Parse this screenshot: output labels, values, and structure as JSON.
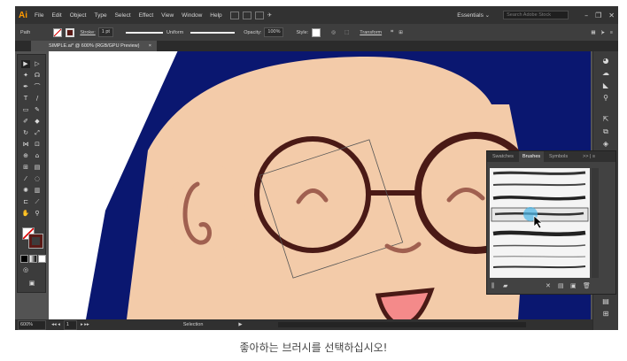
{
  "menubar": {
    "logo": "Ai",
    "items": [
      "File",
      "Edit",
      "Object",
      "Type",
      "Select",
      "Effect",
      "View",
      "Window",
      "Help"
    ],
    "workspace": "Essentials ⌄",
    "search_placeholder": "Search Adobe Stock"
  },
  "control_bar": {
    "selection": "Path",
    "stroke_label": "Stroke:",
    "stroke_weight": "1 pt",
    "profile": "Uniform",
    "opacity_label": "Opacity:",
    "opacity_value": "100%",
    "style_label": "Style:",
    "transform_label": "Transform"
  },
  "document_tab": {
    "title": "SIMPLE.ai* @ 600% (RGB/GPU Preview)",
    "close": "×"
  },
  "status_bar": {
    "zoom": "600%",
    "artboard": "1",
    "tool": "Selection"
  },
  "brushes_panel": {
    "tabs": [
      "Swatches",
      "Brushes",
      "Symbols"
    ],
    "active_tab": "Brushes",
    "menu": ">> | ≡"
  },
  "caption": "좋아하는 브러시를 선택하십시오!",
  "colors": {
    "background_blue": "#0a1770",
    "skin": "#f3cba9",
    "glasses": "#4a1a16",
    "eyes": "#a06050",
    "mouth": "#f48a8a",
    "ui_dark": "#323232"
  }
}
